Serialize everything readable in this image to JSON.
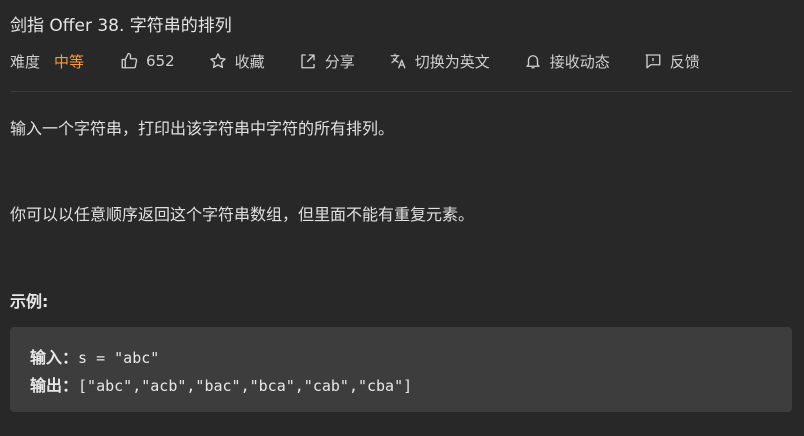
{
  "problem": {
    "title": "剑指 Offer 38. 字符串的排列",
    "difficulty_label": "难度",
    "difficulty_value": "中等",
    "likes": "652",
    "actions": {
      "collect": "收藏",
      "share": "分享",
      "switch_lang": "切换为英文",
      "notify": "接收动态",
      "feedback": "反馈"
    },
    "description": [
      "输入一个字符串，打印出该字符串中字符的所有排列。",
      "你可以以任意顺序返回这个字符串数组，但里面不能有重复元素。"
    ],
    "example_title": "示例:",
    "example": {
      "input_label": "输入：",
      "input_value": "s = \"abc\"",
      "output_label": "输出：",
      "output_value": "[\"abc\",\"acb\",\"bac\",\"bca\",\"cab\",\"cba\"]"
    }
  },
  "colors": {
    "background": "#282828",
    "difficulty_medium": "#ff9a2e",
    "code_background": "#3d3d3d"
  },
  "icons": [
    "thumbs-up-icon",
    "star-icon",
    "share-icon",
    "translate-icon",
    "bell-icon",
    "feedback-icon"
  ]
}
